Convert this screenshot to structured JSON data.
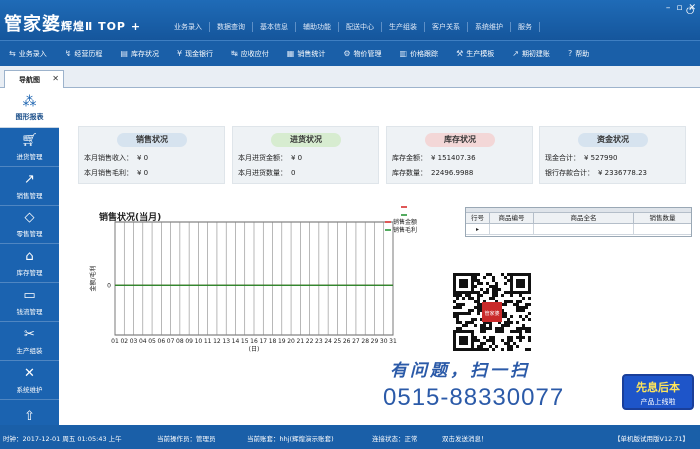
{
  "app": {
    "logo": "管家婆",
    "logo_sub": "辉煌Ⅱ TOP +",
    "top_menu": [
      "业务录入",
      "数据查询",
      "基本信息",
      "辅助功能",
      "配送中心",
      "生产组装",
      "客户关系",
      "系统维护",
      "服务"
    ]
  },
  "toolbar": {
    "items": [
      {
        "icon": "entry-icon",
        "label": "业务录入"
      },
      {
        "icon": "history-icon",
        "label": "经营历程"
      },
      {
        "icon": "inventory-icon",
        "label": "库存状况"
      },
      {
        "icon": "cash-bank-icon",
        "label": "现金银行"
      },
      {
        "icon": "payable-icon",
        "label": "应收应付"
      },
      {
        "icon": "sales-stats-icon",
        "label": "销售统计"
      },
      {
        "icon": "item-manage-icon",
        "label": "物价管理"
      },
      {
        "icon": "price-track-icon",
        "label": "价格跟踪"
      },
      {
        "icon": "production-icon",
        "label": "生产模板"
      },
      {
        "icon": "period-icon",
        "label": "期初建账"
      },
      {
        "icon": "help-icon",
        "label": "帮助"
      }
    ]
  },
  "tab": {
    "label": "导航图"
  },
  "sidebar": {
    "first": {
      "icon": "graph-report-icon",
      "label": "图形报表"
    },
    "items": [
      {
        "icon": "cart-icon",
        "label": "进货管理"
      },
      {
        "icon": "trend-icon",
        "label": "销售管理"
      },
      {
        "icon": "tag-icon",
        "label": "零售管理"
      },
      {
        "icon": "warehouse-icon",
        "label": "库存管理"
      },
      {
        "icon": "money-icon",
        "label": "钱流管理"
      },
      {
        "icon": "tools-icon",
        "label": "生产组装"
      },
      {
        "icon": "wrench-icon",
        "label": "系统维护"
      },
      {
        "icon": "upload-icon",
        "label": ""
      }
    ]
  },
  "cards": [
    {
      "title": "销售状况",
      "title_bg": "#d6e3ef",
      "rows": [
        {
          "k": "本月销售收入：",
          "v": "¥ 0"
        },
        {
          "k": "本月销售毛利：",
          "v": "¥ 0"
        }
      ]
    },
    {
      "title": "进货状况",
      "title_bg": "#d7ecd0",
      "rows": [
        {
          "k": "本月进货金额：",
          "v": "¥ 0"
        },
        {
          "k": "本月进货数量：",
          "v": "0"
        }
      ]
    },
    {
      "title": "库存状况",
      "title_bg": "#f3d7d7",
      "rows": [
        {
          "k": "库存金额：",
          "v": "¥ 151407.36"
        },
        {
          "k": "库存数量：",
          "v": "22496.9988"
        }
      ]
    },
    {
      "title": "资金状况",
      "title_bg": "#d6e3ef",
      "rows": [
        {
          "k": "现金合计：",
          "v": "¥ 527990"
        },
        {
          "k": "银行存款合计：",
          "v": "¥ 2336778.23"
        }
      ]
    }
  ],
  "chart_data": {
    "type": "line",
    "title": "销售状况(当月)",
    "xlabel": "(日)",
    "ylabel": "金额/毛利",
    "categories": [
      "01",
      "02",
      "03",
      "04",
      "05",
      "06",
      "07",
      "08",
      "09",
      "10",
      "11",
      "12",
      "13",
      "14",
      "15",
      "16",
      "17",
      "18",
      "19",
      "20",
      "21",
      "22",
      "23",
      "24",
      "25",
      "26",
      "27",
      "28",
      "29",
      "30",
      "31"
    ],
    "y_ticks": [
      "0"
    ],
    "series": [
      {
        "name": "销售金额",
        "color": "#d42020",
        "values": [
          0,
          0,
          0,
          0,
          0,
          0,
          0,
          0,
          0,
          0,
          0,
          0,
          0,
          0,
          0,
          0,
          0,
          0,
          0,
          0,
          0,
          0,
          0,
          0,
          0,
          0,
          0,
          0,
          0,
          0,
          0
        ]
      },
      {
        "name": "销售毛利",
        "color": "#1a8f2a",
        "values": [
          0,
          0,
          0,
          0,
          0,
          0,
          0,
          0,
          0,
          0,
          0,
          0,
          0,
          0,
          0,
          0,
          0,
          0,
          0,
          0,
          0,
          0,
          0,
          0,
          0,
          0,
          0,
          0,
          0,
          0,
          0
        ]
      }
    ]
  },
  "table": {
    "columns": [
      "行号",
      "商品编号",
      "商品全名",
      "销售数量"
    ],
    "row_marker": "▸"
  },
  "promo": {
    "qr_label": "管家婆",
    "slogan": "有问题，扫一扫",
    "phone": "0515-88330077",
    "badge_title": "先息后本",
    "badge_sub": "产品上线啦"
  },
  "status": {
    "time": "时钟：2017-12-01 周五 01:05:43 上午",
    "operator": "当前操作员：管理员",
    "account": "当前账套：hhj(辉煌演示账套)",
    "connection": "连接状态：正常",
    "message": "双击发送消息！",
    "version": "【单机版试用版V12.71】"
  },
  "colors": {
    "primary": "#1a5fa8",
    "sidebar": "#1b63b0",
    "accent": "#2b5aa8"
  }
}
